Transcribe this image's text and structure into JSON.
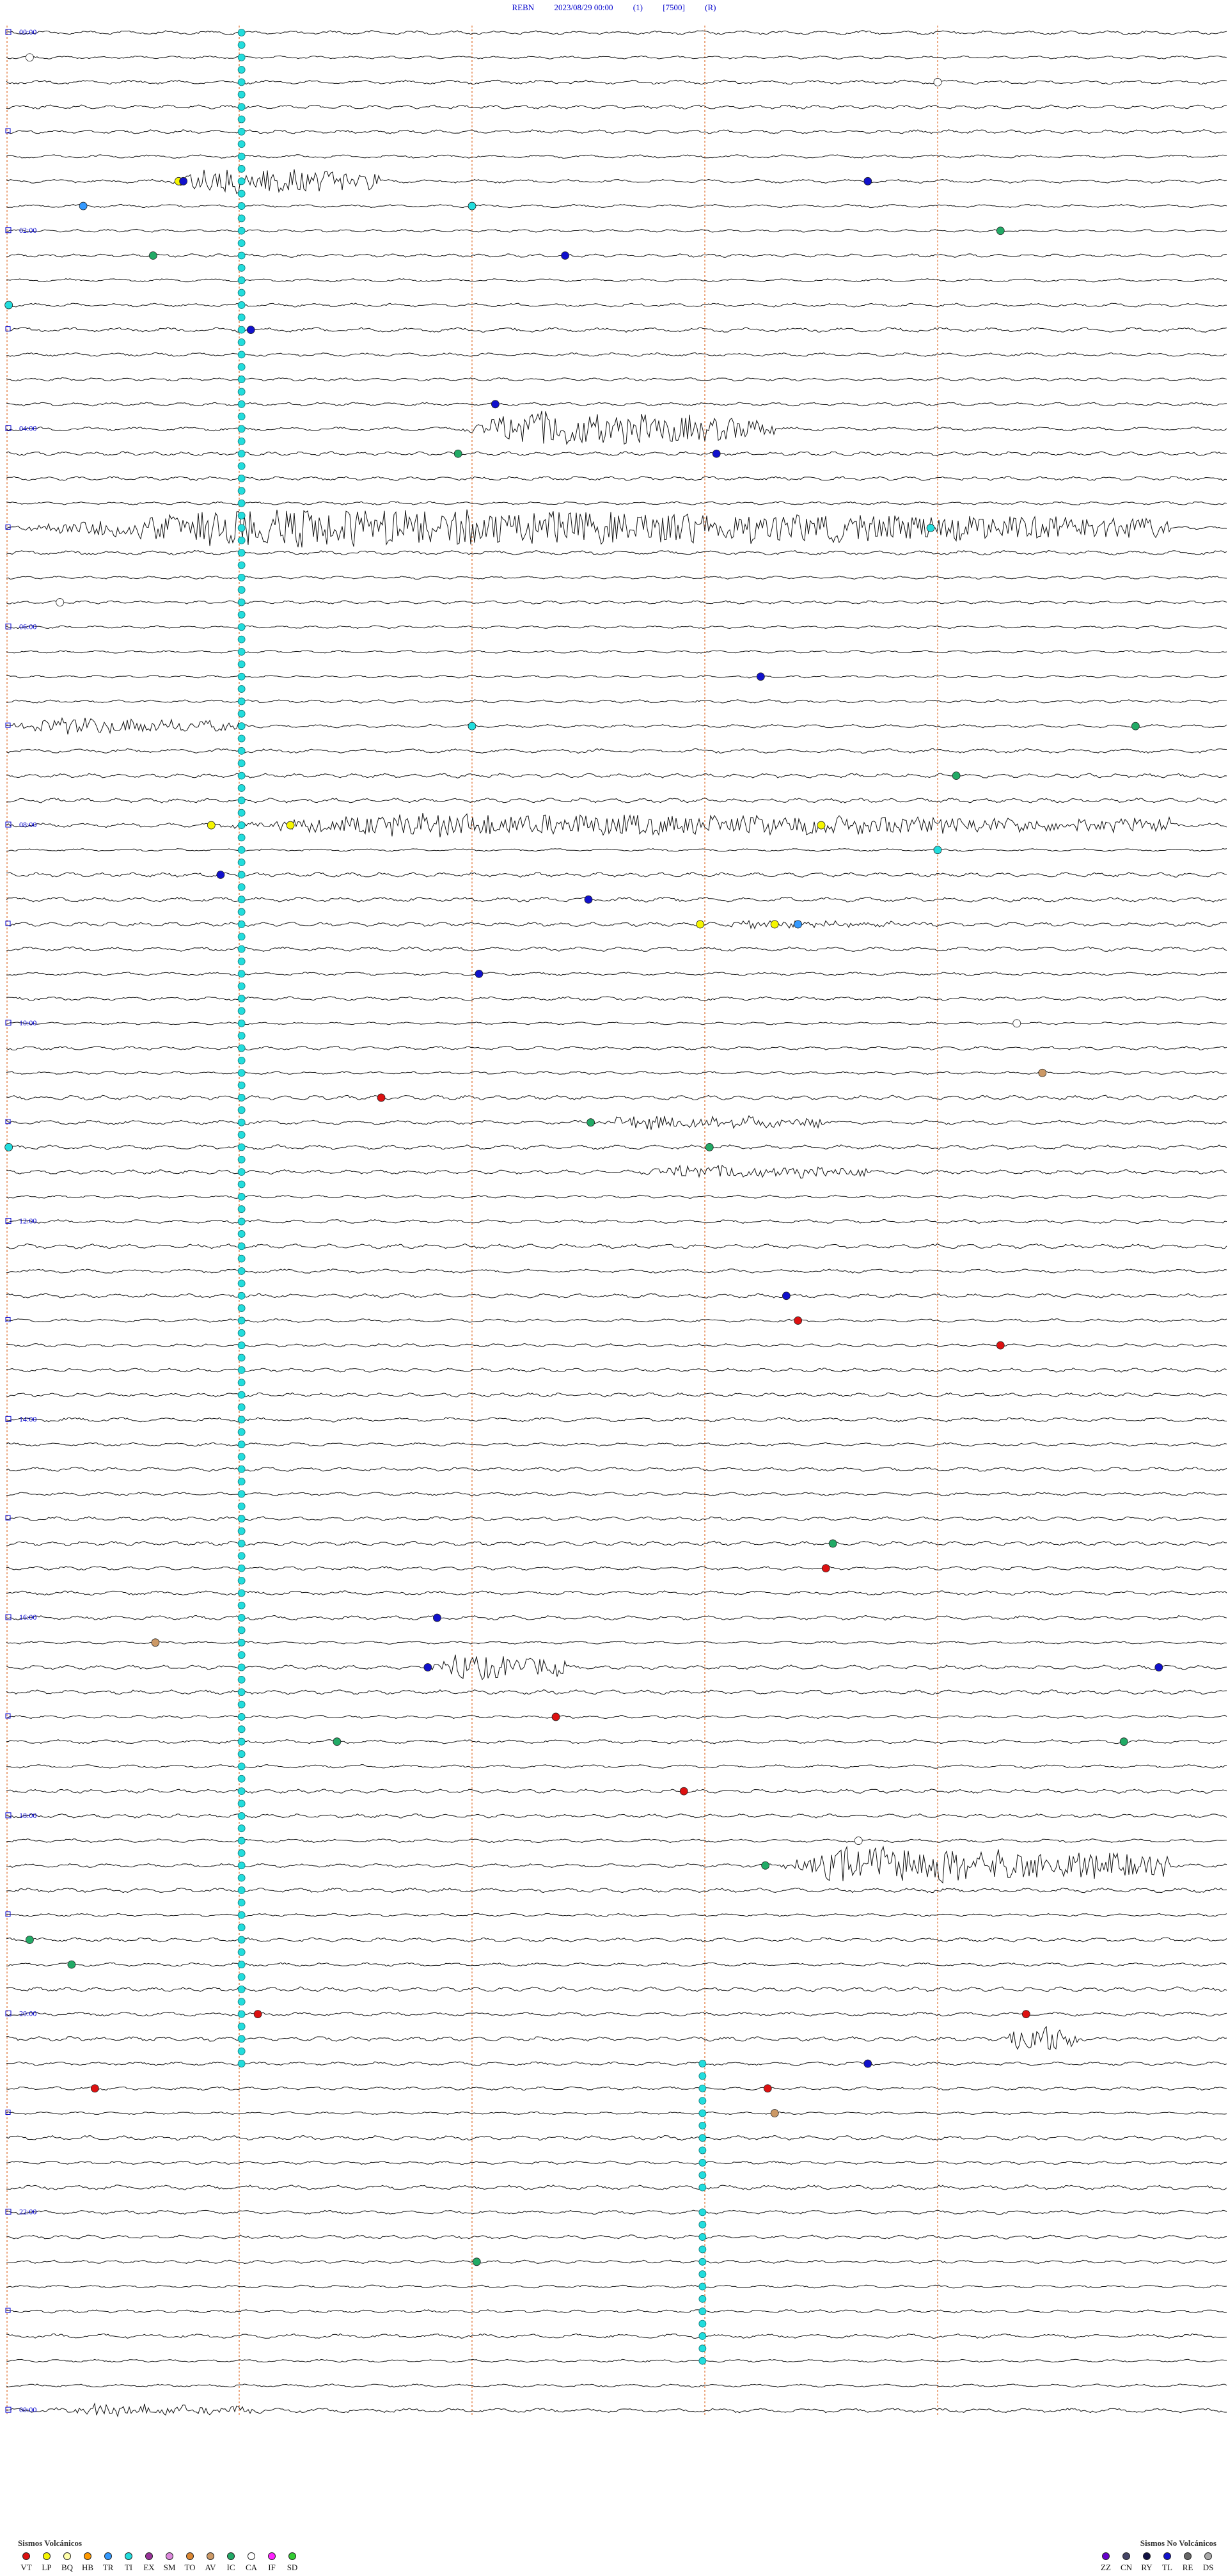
{
  "header": {
    "station": "REBN",
    "datetime": "2023/08/29 00:00",
    "channel": "(1)",
    "scale": "[7500]",
    "mode": "(R)"
  },
  "chart_data": {
    "type": "helicorder",
    "time_labels": [
      "00:00",
      "02:00",
      "04:00",
      "06:00",
      "08:00",
      "10:00",
      "12:00",
      "14:00",
      "16:00",
      "18:00",
      "20:00",
      "22:00",
      "00:00"
    ],
    "lines_per_label": 8,
    "line_count": 97,
    "minute_marks": [
      10,
      20,
      30,
      40
    ],
    "minutes_per_line": 15,
    "colors": {
      "trace": "#111111",
      "time_label": "#0000cc",
      "minute_mark": "#e07030",
      "cyan_pick": "#22dddd"
    },
    "cyan_pick_blocks": [
      {
        "minute": 10.1,
        "from_line": 0,
        "to_line": 82
      },
      {
        "minute": 29.9,
        "from_line": 82,
        "to_line": 87
      },
      {
        "minute": 29.9,
        "from_line": 88,
        "to_line": 94
      }
    ],
    "events": [
      {
        "line": 6,
        "start": 7.0,
        "end": 16.0,
        "amp": 1.3
      },
      {
        "line": 16,
        "start": 19.5,
        "end": 33.0,
        "amp": 1.6
      },
      {
        "line": 20,
        "start": 0.0,
        "end": 50.0,
        "amp": 1.7
      },
      {
        "line": 28,
        "start": 0.0,
        "end": 10.0,
        "amp": 0.7
      },
      {
        "line": 32,
        "start": 8.5,
        "end": 50.0,
        "amp": 1.0
      },
      {
        "line": 36,
        "start": 30.0,
        "end": 40.0,
        "amp": 0.3
      },
      {
        "line": 44,
        "start": 25.0,
        "end": 35.0,
        "amp": 0.6
      },
      {
        "line": 46,
        "start": 27.0,
        "end": 37.0,
        "amp": 0.6
      },
      {
        "line": 66,
        "start": 18.0,
        "end": 24.0,
        "amp": 1.2
      },
      {
        "line": 74,
        "start": 33.0,
        "end": 50.0,
        "amp": 1.7
      },
      {
        "line": 81,
        "start": 43.0,
        "end": 46.0,
        "amp": 1.5
      },
      {
        "line": 96,
        "start": 2.0,
        "end": 11.0,
        "amp": 0.5
      }
    ],
    "picks": [
      {
        "line": 1,
        "minute": 1.0,
        "type": "CA"
      },
      {
        "line": 2,
        "minute": 40.0,
        "type": "CA"
      },
      {
        "line": 6,
        "minute": 7.4,
        "type": "LP"
      },
      {
        "line": 6,
        "minute": 7.6,
        "type": "TL"
      },
      {
        "line": 6,
        "minute": 37.0,
        "type": "TL"
      },
      {
        "line": 7,
        "minute": 20.0,
        "type": "TI"
      },
      {
        "line": 7,
        "minute": 3.3,
        "type": "TR"
      },
      {
        "line": 8,
        "minute": 42.7,
        "type": "IC"
      },
      {
        "line": 9,
        "minute": 6.3,
        "type": "IC"
      },
      {
        "line": 9,
        "minute": 24.0,
        "type": "TL"
      },
      {
        "line": 11,
        "minute": 0.1,
        "type": "TI"
      },
      {
        "line": 12,
        "minute": 10.5,
        "type": "TL"
      },
      {
        "line": 15,
        "minute": 21.0,
        "type": "TL"
      },
      {
        "line": 17,
        "minute": 19.4,
        "type": "IC"
      },
      {
        "line": 17,
        "minute": 30.5,
        "type": "TL"
      },
      {
        "line": 20,
        "minute": 39.7,
        "type": "TI"
      },
      {
        "line": 23,
        "minute": 2.3,
        "type": "CA"
      },
      {
        "line": 26,
        "minute": 32.4,
        "type": "TL"
      },
      {
        "line": 28,
        "minute": 48.5,
        "type": "IC"
      },
      {
        "line": 28,
        "minute": 20.0,
        "type": "TI"
      },
      {
        "line": 30,
        "minute": 40.8,
        "type": "IC"
      },
      {
        "line": 32,
        "minute": 8.8,
        "type": "LP"
      },
      {
        "line": 32,
        "minute": 12.2,
        "type": "LP"
      },
      {
        "line": 32,
        "minute": 35.0,
        "type": "LP"
      },
      {
        "line": 33,
        "minute": 40.0,
        "type": "TI"
      },
      {
        "line": 34,
        "minute": 9.2,
        "type": "TL"
      },
      {
        "line": 35,
        "minute": 25.0,
        "type": "TL"
      },
      {
        "line": 36,
        "minute": 29.8,
        "type": "LP"
      },
      {
        "line": 36,
        "minute": 33.0,
        "type": "LP"
      },
      {
        "line": 36,
        "minute": 34.0,
        "type": "TR"
      },
      {
        "line": 38,
        "minute": 20.3,
        "type": "TL"
      },
      {
        "line": 40,
        "minute": 43.4,
        "type": "CA"
      },
      {
        "line": 42,
        "minute": 44.5,
        "type": "AV"
      },
      {
        "line": 43,
        "minute": 16.1,
        "type": "VT"
      },
      {
        "line": 44,
        "minute": 25.1,
        "type": "IC"
      },
      {
        "line": 45,
        "minute": 30.2,
        "type": "IC"
      },
      {
        "line": 45,
        "minute": 0.1,
        "type": "TI"
      },
      {
        "line": 51,
        "minute": 33.5,
        "type": "TL"
      },
      {
        "line": 52,
        "minute": 34.0,
        "type": "VT"
      },
      {
        "line": 53,
        "minute": 42.7,
        "type": "VT"
      },
      {
        "line": 61,
        "minute": 35.5,
        "type": "IC"
      },
      {
        "line": 62,
        "minute": 35.2,
        "type": "VT"
      },
      {
        "line": 64,
        "minute": 18.5,
        "type": "TL"
      },
      {
        "line": 65,
        "minute": 6.4,
        "type": "AV"
      },
      {
        "line": 66,
        "minute": 18.1,
        "type": "TL"
      },
      {
        "line": 66,
        "minute": 49.5,
        "type": "TL"
      },
      {
        "line": 68,
        "minute": 23.6,
        "type": "VT"
      },
      {
        "line": 69,
        "minute": 14.2,
        "type": "IC"
      },
      {
        "line": 69,
        "minute": 48.0,
        "type": "IC"
      },
      {
        "line": 71,
        "minute": 29.1,
        "type": "VT"
      },
      {
        "line": 73,
        "minute": 36.6,
        "type": "CA"
      },
      {
        "line": 74,
        "minute": 32.6,
        "type": "IC"
      },
      {
        "line": 77,
        "minute": 1.0,
        "type": "IC"
      },
      {
        "line": 78,
        "minute": 2.8,
        "type": "IC"
      },
      {
        "line": 80,
        "minute": 10.8,
        "type": "VT"
      },
      {
        "line": 80,
        "minute": 43.8,
        "type": "VT"
      },
      {
        "line": 82,
        "minute": 37.0,
        "type": "TL"
      },
      {
        "line": 83,
        "minute": 3.8,
        "type": "VT"
      },
      {
        "line": 83,
        "minute": 32.7,
        "type": "VT"
      },
      {
        "line": 84,
        "minute": 33.0,
        "type": "AV"
      },
      {
        "line": 90,
        "minute": 20.2,
        "type": "IC"
      }
    ],
    "legend_volcanic_title": "Sismos Volcánicos",
    "legend_volcanic": [
      {
        "code": "VT",
        "color": "#dd1111"
      },
      {
        "code": "LP",
        "color": "#f5f500"
      },
      {
        "code": "BQ",
        "color": "#ffffaa"
      },
      {
        "code": "HB",
        "color": "#ff9900"
      },
      {
        "code": "TR",
        "color": "#3399ff"
      },
      {
        "code": "TI",
        "color": "#22dddd"
      },
      {
        "code": "EX",
        "color": "#993399"
      },
      {
        "code": "SM",
        "color": "#dd88dd"
      },
      {
        "code": "TO",
        "color": "#dd8833"
      },
      {
        "code": "AV",
        "color": "#cc9966"
      },
      {
        "code": "IC",
        "color": "#22aa66"
      },
      {
        "code": "CA",
        "color": "#ffffff"
      },
      {
        "code": "IF",
        "color": "#ff22ff"
      },
      {
        "code": "SD",
        "color": "#33cc33"
      }
    ],
    "legend_nonvolcanic_title": "Sismos No Volcánicos",
    "legend_nonvolcanic": [
      {
        "code": "ZZ",
        "color": "#6600cc"
      },
      {
        "code": "CN",
        "color": "#444466"
      },
      {
        "code": "RY",
        "color": "#111144"
      },
      {
        "code": "TL",
        "color": "#1111cc"
      },
      {
        "code": "RE",
        "color": "#666666"
      },
      {
        "code": "DS",
        "color": "#aaaaaa"
      }
    ]
  }
}
